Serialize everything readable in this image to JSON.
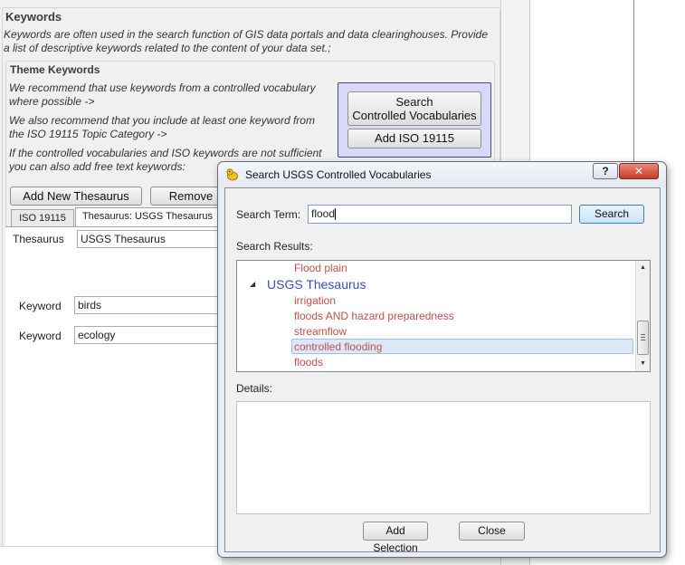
{
  "background": {
    "keywords_title": "Keywords",
    "keywords_desc_1": "Keywords are often used in the search function of GIS data portals and data clearinghouses. Provide",
    "keywords_desc_2": "a list of descriptive keywords related to the content of your data set.;",
    "theme_title": "Theme Keywords",
    "note_1a": "We recommend that use keywords from a controlled vocabulary",
    "note_1b": "where possible ->",
    "note_2a": "We also recommend that you include at least one keyword from",
    "note_2b": "the ISO 19115 Topic Category ->",
    "note_3a": "If the controlled vocabularies and ISO keywords are not sufficient",
    "note_3b": "you can also add free text keywords:",
    "search_cv_line1": "Search",
    "search_cv_line2": "Controlled Vocabularies",
    "add_iso_label": "Add ISO 19115",
    "add_thesaurus_label": "Add New Thesaurus",
    "remove_label": "Remove",
    "tabs": [
      {
        "label": "ISO 19115",
        "active": false
      },
      {
        "label": "Thesaurus: USGS Thesaurus",
        "active": true
      }
    ],
    "thesaurus_label": "Thesaurus",
    "thesaurus_value": "USGS Thesaurus",
    "keyword_label": "Keyword",
    "keywords": [
      "birds",
      "ecology"
    ]
  },
  "dialog": {
    "title": "Search USGS Controlled Vocabularies",
    "help_glyph": "?",
    "close_glyph": "✕",
    "search_term_label": "Search Term:",
    "search_term_value": "flood",
    "search_button": "Search",
    "results_label": "Search Results:",
    "results": {
      "top_item": "Flood plain",
      "group": "USGS Thesaurus",
      "items": [
        "irrigation",
        "floods AND hazard preparedness",
        "streamflow",
        "controlled flooding",
        "floods"
      ],
      "selected_index": 3
    },
    "details_label": "Details:",
    "details_value": "",
    "add_selection": "Add Selection",
    "close": "Close",
    "colors": {
      "item": "#c0504d",
      "group": "#3a4fb8",
      "selection": "#dce8f8"
    }
  }
}
